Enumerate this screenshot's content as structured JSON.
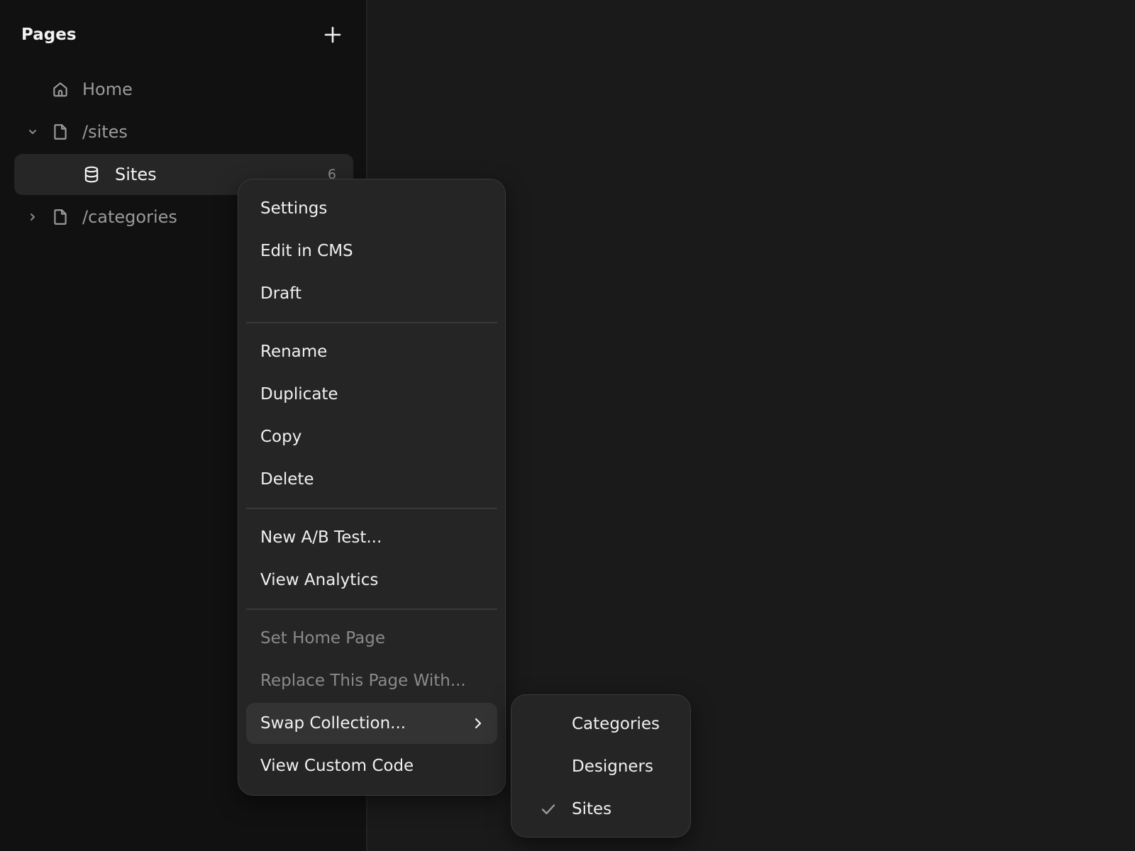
{
  "sidebar": {
    "title": "Pages",
    "add_icon": "plus-icon",
    "items": [
      {
        "label": "Home",
        "icon": "home-icon"
      },
      {
        "label": "/sites",
        "icon": "page-icon",
        "expanded": true
      },
      {
        "label": "Sites",
        "icon": "database-icon",
        "count": "6",
        "selected": true
      },
      {
        "label": "/categories",
        "icon": "page-icon",
        "expanded": false
      }
    ]
  },
  "context_menu": {
    "items": [
      {
        "label": "Settings"
      },
      {
        "label": "Edit in CMS"
      },
      {
        "label": "Draft"
      },
      {
        "label": "Rename"
      },
      {
        "label": "Duplicate"
      },
      {
        "label": "Copy"
      },
      {
        "label": "Delete"
      },
      {
        "label": "New A/B Test..."
      },
      {
        "label": "View Analytics"
      },
      {
        "label": "Set Home Page",
        "disabled": true
      },
      {
        "label": "Replace This Page With...",
        "disabled": true
      },
      {
        "label": "Swap Collection...",
        "has_submenu": true,
        "highlighted": true
      },
      {
        "label": "View Custom Code"
      }
    ]
  },
  "submenu": {
    "items": [
      {
        "label": "Categories",
        "checked": false
      },
      {
        "label": "Designers",
        "checked": false
      },
      {
        "label": "Sites",
        "checked": true
      }
    ]
  },
  "colors": {
    "sidebar_bg": "#111111",
    "canvas_bg": "#1a1a1a",
    "menu_bg": "#252525",
    "highlight_bg": "#333333",
    "text_primary": "#f0f0f0",
    "text_muted": "#9a9a9a"
  }
}
